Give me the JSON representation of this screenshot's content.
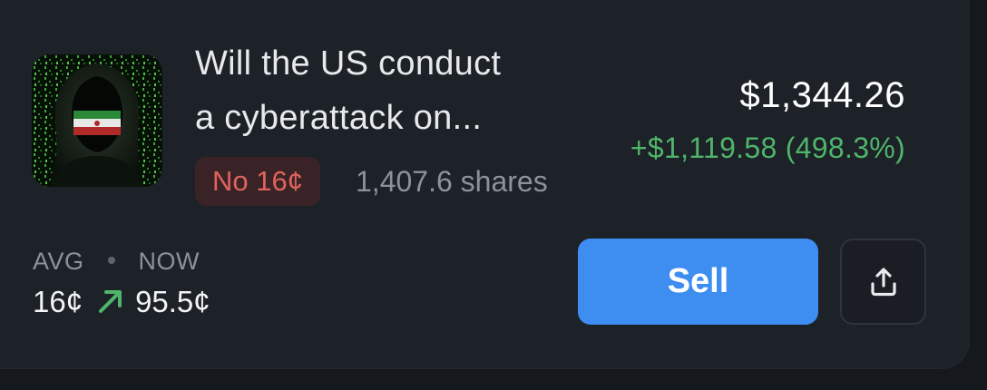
{
  "market": {
    "title_line1": "Will the US conduct",
    "title_line2": "a cyberattack on...",
    "image_icon": "hooded-hacker-image"
  },
  "position": {
    "outcome_badge": "No 16¢",
    "shares": "1,407.6 shares",
    "value": "$1,344.26",
    "pnl": "+$1,119.58 (498.3%)"
  },
  "prices": {
    "avg_label": "AVG",
    "now_label": "NOW",
    "avg_value": "16¢",
    "now_value": "95.5¢",
    "trend_icon": "arrow-up-right-icon"
  },
  "actions": {
    "sell_label": "Sell",
    "share_icon": "share-upload-icon"
  },
  "colors": {
    "background": "#15181d",
    "card": "#1d2128",
    "accent_blue": "#3e8ef2",
    "positive_green": "#4fb56a",
    "negative_red": "#e0625d"
  }
}
